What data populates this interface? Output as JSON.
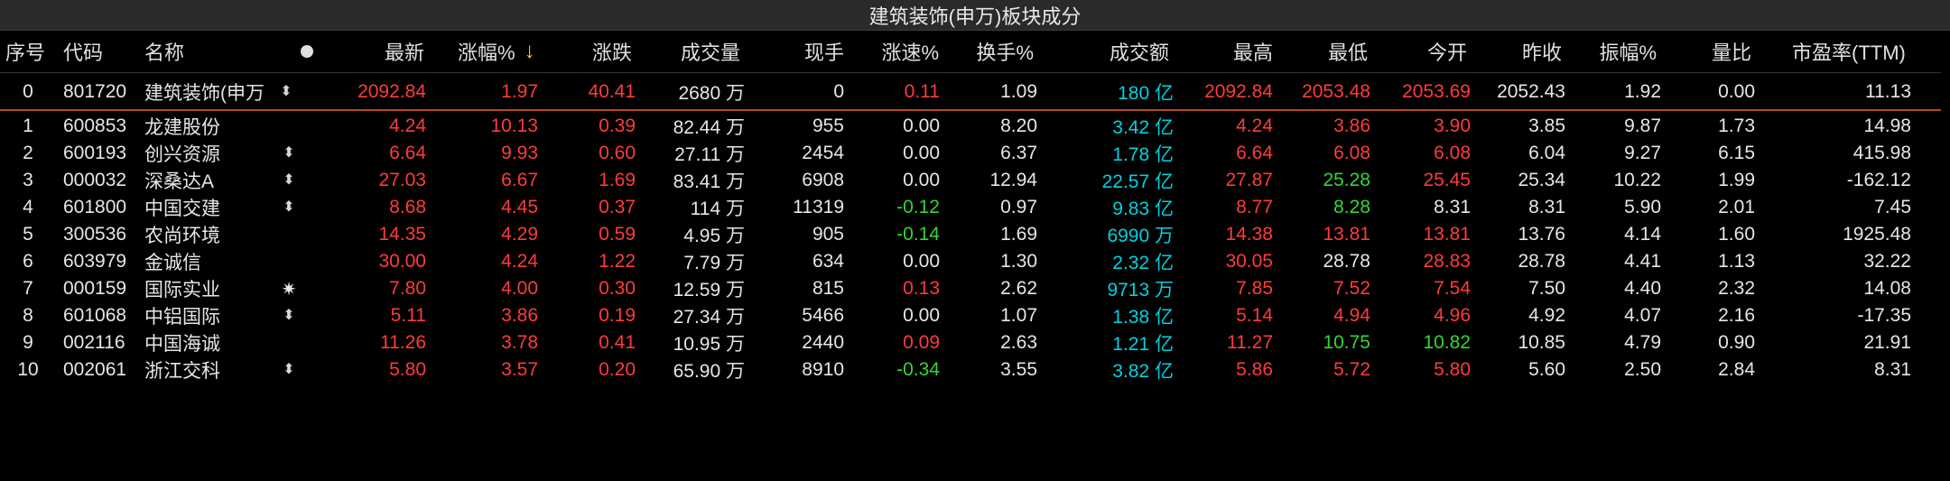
{
  "title": "建筑装饰(申万)板块成分",
  "headers": {
    "seq": "序号",
    "code": "代码",
    "name": "名称",
    "latest": "最新",
    "change_pct": "涨幅%",
    "change": "涨跌",
    "volume": "成交量",
    "cur_vol": "现手",
    "speed": "涨速%",
    "turnover": "换手%",
    "amount": "成交额",
    "high": "最高",
    "low": "最低",
    "open": "今开",
    "prev_close": "昨收",
    "amplitude": "振幅%",
    "vol_ratio": "量比",
    "pe": "市盈率(TTM)"
  },
  "icons": {
    "header_dot": "dot-icon",
    "sort": "sort-desc-arrow-icon",
    "sort_glyph": "↓",
    "updown_glyph": "⬍",
    "sun_glyph": "✷"
  },
  "colors": {
    "red": "#ff3b3b",
    "green": "#33d633",
    "cyan": "#00d2e0",
    "white": "#e6e6e6",
    "sort_arrow": "#ffd21e",
    "index_divider": "#b44a2a"
  },
  "rows": [
    {
      "seq": "0",
      "code": "801720",
      "name": "建筑装饰(申万",
      "icon": "updown",
      "latest": "2092.84",
      "change_pct": "1.97",
      "change": "40.41",
      "volume": "2680 万",
      "cur_vol": "0",
      "speed": "0.11",
      "turnover": "1.09",
      "amount": "180 亿",
      "high": "2092.84",
      "low": "2053.48",
      "open": "2053.69",
      "prev_close": "2052.43",
      "amplitude": "1.92",
      "vol_ratio": "0.00",
      "pe": "11.13",
      "c": {
        "latest": "red",
        "change_pct": "red",
        "change": "red",
        "speed": "red",
        "high": "red",
        "low": "red",
        "open": "red"
      }
    },
    {
      "seq": "1",
      "code": "600853",
      "name": "龙建股份",
      "icon": "",
      "latest": "4.24",
      "change_pct": "10.13",
      "change": "0.39",
      "volume": "82.44 万",
      "cur_vol": "955",
      "speed": "0.00",
      "turnover": "8.20",
      "amount": "3.42 亿",
      "high": "4.24",
      "low": "3.86",
      "open": "3.90",
      "prev_close": "3.85",
      "amplitude": "9.87",
      "vol_ratio": "1.73",
      "pe": "14.98",
      "c": {
        "latest": "red",
        "change_pct": "red",
        "change": "red",
        "speed": "white",
        "high": "red",
        "low": "red",
        "open": "red"
      }
    },
    {
      "seq": "2",
      "code": "600193",
      "name": "创兴资源",
      "icon": "updown",
      "latest": "6.64",
      "change_pct": "9.93",
      "change": "0.60",
      "volume": "27.11 万",
      "cur_vol": "2454",
      "speed": "0.00",
      "turnover": "6.37",
      "amount": "1.78 亿",
      "high": "6.64",
      "low": "6.08",
      "open": "6.08",
      "prev_close": "6.04",
      "amplitude": "9.27",
      "vol_ratio": "6.15",
      "pe": "415.98",
      "c": {
        "latest": "red",
        "change_pct": "red",
        "change": "red",
        "speed": "white",
        "high": "red",
        "low": "red",
        "open": "red"
      }
    },
    {
      "seq": "3",
      "code": "000032",
      "name": "深桑达A",
      "icon": "updown",
      "latest": "27.03",
      "change_pct": "6.67",
      "change": "1.69",
      "volume": "83.41 万",
      "cur_vol": "6908",
      "speed": "0.00",
      "turnover": "12.94",
      "amount": "22.57 亿",
      "high": "27.87",
      "low": "25.28",
      "open": "25.45",
      "prev_close": "25.34",
      "amplitude": "10.22",
      "vol_ratio": "1.99",
      "pe": "-162.12",
      "c": {
        "latest": "red",
        "change_pct": "red",
        "change": "red",
        "speed": "white",
        "high": "red",
        "low": "green",
        "open": "red"
      }
    },
    {
      "seq": "4",
      "code": "601800",
      "name": "中国交建",
      "icon": "updown",
      "latest": "8.68",
      "change_pct": "4.45",
      "change": "0.37",
      "volume": "114 万",
      "cur_vol": "11319",
      "speed": "-0.12",
      "turnover": "0.97",
      "amount": "9.83 亿",
      "high": "8.77",
      "low": "8.28",
      "open": "8.31",
      "prev_close": "8.31",
      "amplitude": "5.90",
      "vol_ratio": "2.01",
      "pe": "7.45",
      "c": {
        "latest": "red",
        "change_pct": "red",
        "change": "red",
        "speed": "green",
        "high": "red",
        "low": "green",
        "open": "white"
      }
    },
    {
      "seq": "5",
      "code": "300536",
      "name": "农尚环境",
      "icon": "",
      "latest": "14.35",
      "change_pct": "4.29",
      "change": "0.59",
      "volume": "4.95 万",
      "cur_vol": "905",
      "speed": "-0.14",
      "turnover": "1.69",
      "amount": "6990 万",
      "high": "14.38",
      "low": "13.81",
      "open": "13.81",
      "prev_close": "13.76",
      "amplitude": "4.14",
      "vol_ratio": "1.60",
      "pe": "1925.48",
      "c": {
        "latest": "red",
        "change_pct": "red",
        "change": "red",
        "speed": "green",
        "high": "red",
        "low": "red",
        "open": "red"
      }
    },
    {
      "seq": "6",
      "code": "603979",
      "name": "金诚信",
      "icon": "",
      "latest": "30.00",
      "change_pct": "4.24",
      "change": "1.22",
      "volume": "7.79 万",
      "cur_vol": "634",
      "speed": "0.00",
      "turnover": "1.30",
      "amount": "2.32 亿",
      "high": "30.05",
      "low": "28.78",
      "open": "28.83",
      "prev_close": "28.78",
      "amplitude": "4.41",
      "vol_ratio": "1.13",
      "pe": "32.22",
      "c": {
        "latest": "red",
        "change_pct": "red",
        "change": "red",
        "speed": "white",
        "high": "red",
        "low": "white",
        "open": "red"
      }
    },
    {
      "seq": "7",
      "code": "000159",
      "name": "国际实业",
      "icon": "sun",
      "latest": "7.80",
      "change_pct": "4.00",
      "change": "0.30",
      "volume": "12.59 万",
      "cur_vol": "815",
      "speed": "0.13",
      "turnover": "2.62",
      "amount": "9713 万",
      "high": "7.85",
      "low": "7.52",
      "open": "7.54",
      "prev_close": "7.50",
      "amplitude": "4.40",
      "vol_ratio": "2.32",
      "pe": "14.08",
      "c": {
        "latest": "red",
        "change_pct": "red",
        "change": "red",
        "speed": "red",
        "high": "red",
        "low": "red",
        "open": "red"
      }
    },
    {
      "seq": "8",
      "code": "601068",
      "name": "中铝国际",
      "icon": "updown",
      "latest": "5.11",
      "change_pct": "3.86",
      "change": "0.19",
      "volume": "27.34 万",
      "cur_vol": "5466",
      "speed": "0.00",
      "turnover": "1.07",
      "amount": "1.38 亿",
      "high": "5.14",
      "low": "4.94",
      "open": "4.96",
      "prev_close": "4.92",
      "amplitude": "4.07",
      "vol_ratio": "2.16",
      "pe": "-17.35",
      "c": {
        "latest": "red",
        "change_pct": "red",
        "change": "red",
        "speed": "white",
        "high": "red",
        "low": "red",
        "open": "red"
      }
    },
    {
      "seq": "9",
      "code": "002116",
      "name": "中国海诚",
      "icon": "",
      "latest": "11.26",
      "change_pct": "3.78",
      "change": "0.41",
      "volume": "10.95 万",
      "cur_vol": "2440",
      "speed": "0.09",
      "turnover": "2.63",
      "amount": "1.21 亿",
      "high": "11.27",
      "low": "10.75",
      "open": "10.82",
      "prev_close": "10.85",
      "amplitude": "4.79",
      "vol_ratio": "0.90",
      "pe": "21.91",
      "c": {
        "latest": "red",
        "change_pct": "red",
        "change": "red",
        "speed": "red",
        "high": "red",
        "low": "green",
        "open": "green"
      }
    },
    {
      "seq": "10",
      "code": "002061",
      "name": "浙江交科",
      "icon": "updown",
      "latest": "5.80",
      "change_pct": "3.57",
      "change": "0.20",
      "volume": "65.90 万",
      "cur_vol": "8910",
      "speed": "-0.34",
      "turnover": "3.55",
      "amount": "3.82 亿",
      "high": "5.86",
      "low": "5.72",
      "open": "5.80",
      "prev_close": "5.60",
      "amplitude": "2.50",
      "vol_ratio": "2.84",
      "pe": "8.31",
      "c": {
        "latest": "red",
        "change_pct": "red",
        "change": "red",
        "speed": "green",
        "high": "red",
        "low": "red",
        "open": "red"
      }
    }
  ]
}
